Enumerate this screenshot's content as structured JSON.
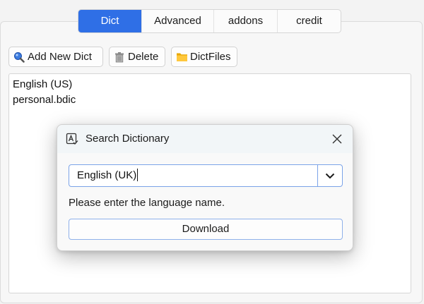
{
  "tabs": [
    {
      "label": "Dict",
      "active": true
    },
    {
      "label": "Advanced",
      "active": false
    },
    {
      "label": "addons",
      "active": false
    },
    {
      "label": "credit",
      "active": false
    }
  ],
  "toolbar": {
    "add_label": "Add New Dict",
    "add_icon": "magnifier-icon",
    "delete_label": "Delete",
    "delete_icon": "trash-icon",
    "files_label": "DictFiles",
    "files_icon": "folder-icon"
  },
  "dict_list": {
    "items": [
      "English (US)",
      "personal.bdic"
    ]
  },
  "dialog": {
    "title": "Search Dictionary",
    "title_icon": "dictionary-icon",
    "language_value": "English (UK)",
    "hint": "Please enter the language name.",
    "download_label": "Download"
  },
  "colors": {
    "accent": "#2f6fe6",
    "combo_border": "#7ba3e8",
    "background": "#f3f3f3"
  }
}
